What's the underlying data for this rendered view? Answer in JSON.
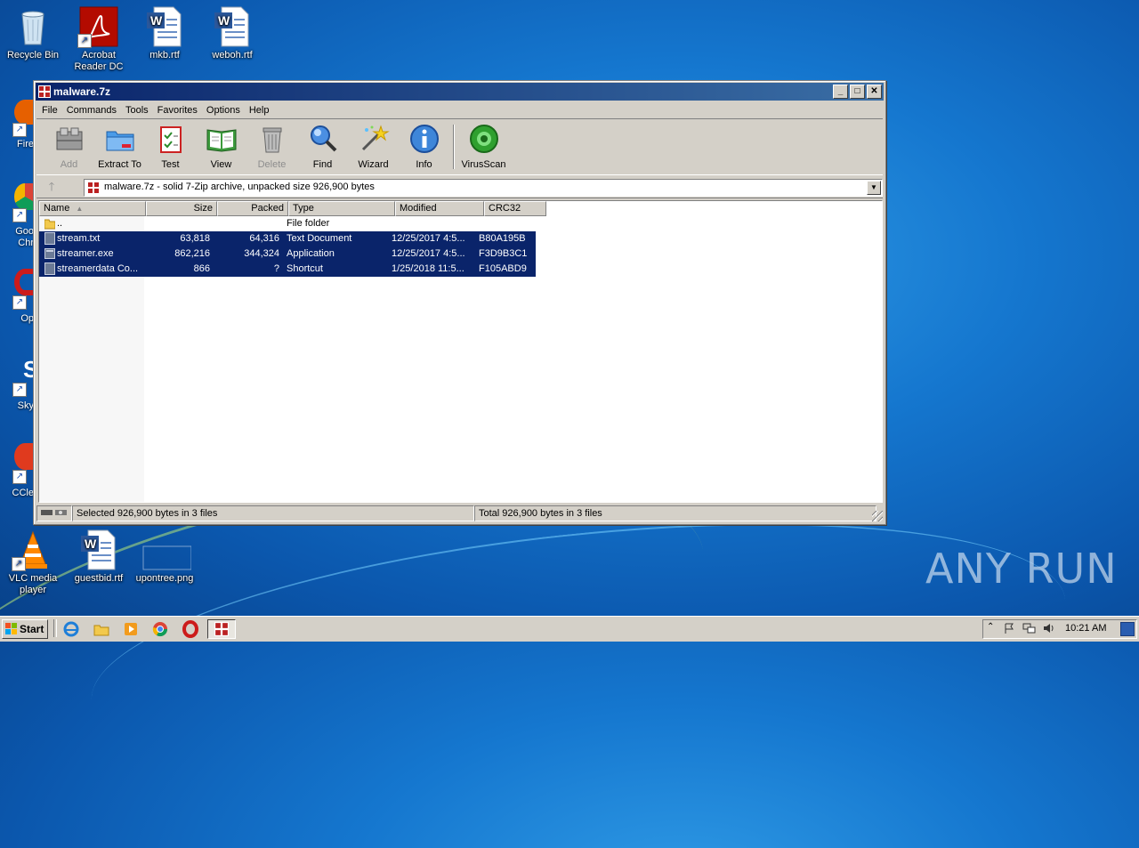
{
  "desktop": {
    "icons": [
      {
        "label": "Recycle Bin",
        "icon": "recycle-bin-icon"
      },
      {
        "label": "Acrobat Reader DC",
        "icon": "acrobat-icon"
      },
      {
        "label": "mkb.rtf",
        "icon": "word-doc-icon"
      },
      {
        "label": "weboh.rtf",
        "icon": "word-doc-icon"
      },
      {
        "label": "VLC media player",
        "icon": "vlc-icon"
      },
      {
        "label": "guestbid.rtf",
        "icon": "word-doc-icon"
      },
      {
        "label": "upontree.png",
        "icon": "image-icon"
      }
    ],
    "partial_labels": [
      "Fire",
      "Goo",
      "Chr",
      "Op",
      "Sky",
      "CCle"
    ]
  },
  "window": {
    "title": "malware.7z",
    "menu": [
      "File",
      "Commands",
      "Tools",
      "Favorites",
      "Options",
      "Help"
    ],
    "toolbar": [
      {
        "label": "Add",
        "icon": "add-archive-icon",
        "disabled": true
      },
      {
        "label": "Extract To",
        "icon": "extract-folder-icon",
        "disabled": false
      },
      {
        "label": "Test",
        "icon": "test-checklist-icon",
        "disabled": false
      },
      {
        "label": "View",
        "icon": "view-book-icon",
        "disabled": false
      },
      {
        "label": "Delete",
        "icon": "trash-icon",
        "disabled": true
      },
      {
        "label": "Find",
        "icon": "magnifier-icon",
        "disabled": false
      },
      {
        "label": "Wizard",
        "icon": "wizard-wand-icon",
        "disabled": false
      },
      {
        "label": "Info",
        "icon": "info-icon",
        "disabled": false
      },
      {
        "label": "VirusScan",
        "icon": "virus-scan-icon",
        "disabled": false
      }
    ],
    "address": "malware.7z - solid 7-Zip archive, unpacked size 926,900 bytes",
    "columns": [
      "Name",
      "Size",
      "Packed",
      "Type",
      "Modified",
      "CRC32"
    ],
    "rows": [
      {
        "name": "..",
        "size": "",
        "packed": "",
        "type": "File folder",
        "modified": "",
        "crc": "",
        "selected": false,
        "icon": "folder-icon"
      },
      {
        "name": "stream.txt",
        "size": "63,818",
        "packed": "64,316",
        "type": "Text Document",
        "modified": "12/25/2017 4:5...",
        "crc": "B80A195B",
        "selected": true,
        "icon": "text-file-icon"
      },
      {
        "name": "streamer.exe",
        "size": "862,216",
        "packed": "344,324",
        "type": "Application",
        "modified": "12/25/2017 4:5...",
        "crc": "F3D9B3C1",
        "selected": true,
        "icon": "exe-file-icon"
      },
      {
        "name": "streamerdata Co...",
        "size": "866",
        "packed": "?",
        "type": "Shortcut",
        "modified": "1/25/2018 11:5...",
        "crc": "F105ABD9",
        "selected": true,
        "icon": "shortcut-file-icon"
      }
    ],
    "status_left": "Selected 926,900 bytes in 3 files",
    "status_right": "Total 926,900 bytes in 3 files"
  },
  "taskbar": {
    "start_label": "Start",
    "clock": "10:21 AM"
  },
  "watermark": "ANY RUN"
}
